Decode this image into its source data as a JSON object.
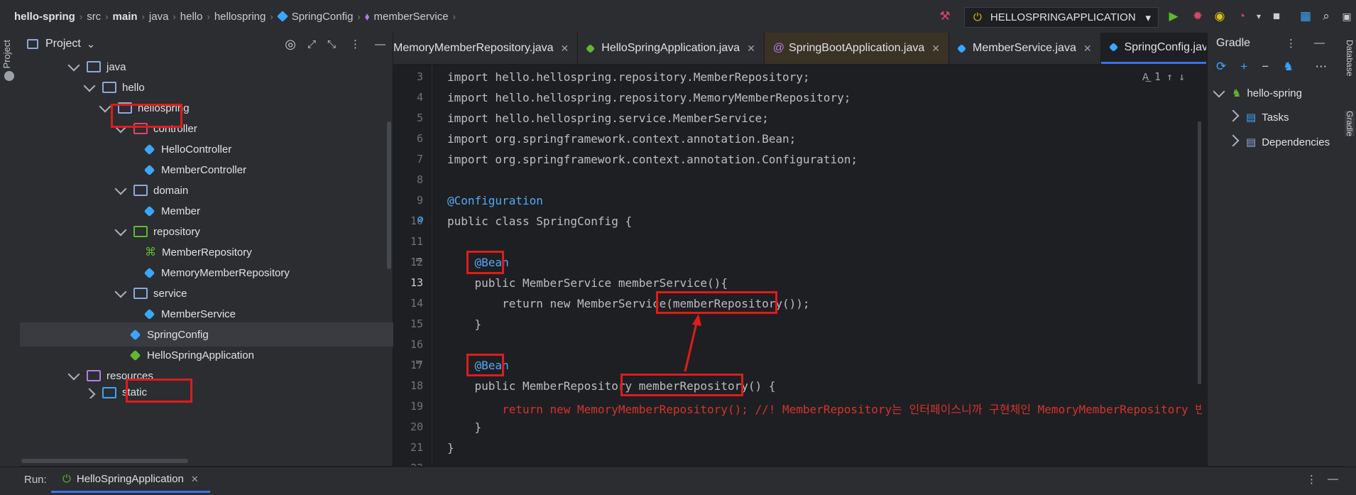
{
  "breadcrumbs": [
    "hello-spring",
    "src",
    "main",
    "java",
    "hello",
    "hellospring",
    "SpringConfig",
    "memberService"
  ],
  "run_config": "HELLOSPRINGAPPLICATION",
  "project_panel": {
    "title": "Project",
    "tree": [
      {
        "label": "java",
        "type": "folder",
        "level": 1
      },
      {
        "label": "hello",
        "type": "folder",
        "level": 2
      },
      {
        "label": "hellospring",
        "type": "folder",
        "level": 3,
        "highlight": true
      },
      {
        "label": "controller",
        "type": "folder",
        "level": 4
      },
      {
        "label": "HelloController",
        "type": "class",
        "level": 5
      },
      {
        "label": "MemberController",
        "type": "class",
        "level": 5
      },
      {
        "label": "domain",
        "type": "folder",
        "level": 4
      },
      {
        "label": "Member",
        "type": "class",
        "level": 5
      },
      {
        "label": "repository",
        "type": "folder",
        "level": 4
      },
      {
        "label": "MemberRepository",
        "type": "interface",
        "level": 5
      },
      {
        "label": "MemoryMemberRepository",
        "type": "class",
        "level": 5
      },
      {
        "label": "service",
        "type": "folder",
        "level": 4
      },
      {
        "label": "MemberService",
        "type": "class",
        "level": 5
      },
      {
        "label": "SpringConfig",
        "type": "class",
        "level": 4,
        "highlight": true,
        "selected": true
      },
      {
        "label": "HelloSpringApplication",
        "type": "class",
        "level": 4
      },
      {
        "label": "resources",
        "type": "folder",
        "level": 1
      },
      {
        "label": "static",
        "type": "folder",
        "level": 2
      }
    ]
  },
  "tabs": [
    {
      "label": "MemoryMemberRepository.java",
      "active": false
    },
    {
      "label": "HelloSpringApplication.java",
      "active": false
    },
    {
      "label": "SpringBootApplication.java",
      "active": false
    },
    {
      "label": "MemberService.java",
      "active": false
    },
    {
      "label": "SpringConfig.java",
      "active": true
    }
  ],
  "inspection": "1",
  "code_lines": [
    {
      "n": "3",
      "t": "import hello.hellospring.repository.MemberRepository;"
    },
    {
      "n": "4",
      "t": "import hello.hellospring.repository.MemoryMemberRepository;"
    },
    {
      "n": "5",
      "t": "import hello.hellospring.service.MemberService;"
    },
    {
      "n": "6",
      "t": "import org.springframework.context.annotation.Bean;"
    },
    {
      "n": "7",
      "t": "import org.springframework.context.annotation.Configuration;"
    },
    {
      "n": "8",
      "t": ""
    },
    {
      "n": "9",
      "t": "@Configuration"
    },
    {
      "n": "10",
      "t": "public class SpringConfig {"
    },
    {
      "n": "11",
      "t": ""
    },
    {
      "n": "12",
      "t": "    @Bean"
    },
    {
      "n": "13",
      "t": "    public MemberService memberService(){"
    },
    {
      "n": "14",
      "t": "        return new MemberService(memberRepository());"
    },
    {
      "n": "15",
      "t": "    }"
    },
    {
      "n": "16",
      "t": ""
    },
    {
      "n": "17",
      "t": "    @Bean"
    },
    {
      "n": "18",
      "t": "    public MemberRepository memberRepository() {"
    },
    {
      "n": "19",
      "t": "        return new MemoryMemberRepository(); //! MemberRepository는 인터페이스니까 구현체인 MemoryMemberRepository 반환!"
    },
    {
      "n": "20",
      "t": "    }"
    },
    {
      "n": "21",
      "t": "}"
    },
    {
      "n": "22",
      "t": ""
    }
  ],
  "gradle": {
    "title": "Gradle",
    "tree": [
      {
        "label": "hello-spring",
        "level": 0
      },
      {
        "label": "Tasks",
        "level": 1
      },
      {
        "label": "Dependencies",
        "level": 1
      }
    ]
  },
  "side_labels": {
    "left": "Project",
    "right_top": "Database",
    "right_bottom": "Gradle"
  },
  "run_bar": {
    "label": "Run:",
    "tab": "HelloSpringApplication"
  },
  "colors": {
    "highlight_box": "#e01b1b",
    "accent": "#3574f0",
    "keyword": "#cf8e6d",
    "function": "#56a8f5",
    "comment": "#d3342e"
  }
}
